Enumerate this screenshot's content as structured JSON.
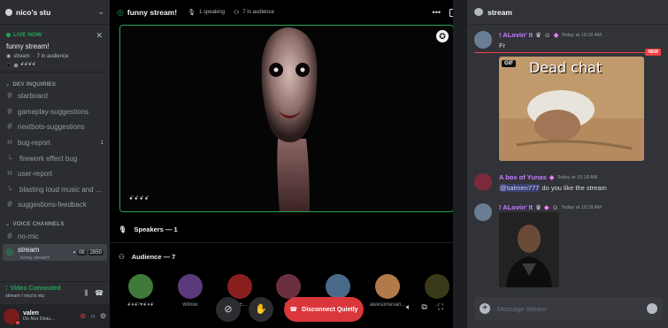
{
  "server": {
    "name": "nico's stu"
  },
  "live": {
    "label": "LIVE NOW",
    "title": "funny stream!",
    "channel": "stream",
    "audience": "7 in audience",
    "audience_tag": "ꗃꗃꗃꗃ"
  },
  "sidebar": {
    "category_text": "DEV INQUIRIES",
    "channels": [
      {
        "label": "starboard",
        "type": "text"
      },
      {
        "label": "gameplay-suggestions",
        "type": "text"
      },
      {
        "label": "nextbots-suggestions",
        "type": "text"
      },
      {
        "label": "bug-report",
        "type": "forum",
        "badge": "1"
      },
      {
        "label": "firework effect bug",
        "type": "thread"
      },
      {
        "label": "user-report",
        "type": "forum"
      },
      {
        "label": "blasting loud music and ...",
        "type": "thread"
      },
      {
        "label": "suggestions-feedback",
        "type": "text"
      }
    ],
    "category_voice": "VOICE CHANNELS",
    "voice_channels": [
      {
        "label": "no-mic"
      },
      {
        "label": "stream",
        "sub": "funny stream!",
        "count_a": "08",
        "count_b": "2850"
      }
    ]
  },
  "voice_status": {
    "label": "Video Connected",
    "sub": "stream / nico's stu"
  },
  "user": {
    "name": "valen",
    "status": "Do Not Distu..."
  },
  "stream": {
    "title": "funny stream!",
    "speaking": "1 speaking",
    "audience": "7 in audience",
    "video_tag": "ꗃꗃꗃꗃ",
    "speakers_label": "Speakers — 1",
    "audience_label": "Audience — 7",
    "members": [
      {
        "name": "ꗃ♦ꗃ/♥ꗃ♦ꗃ",
        "color": "#3f7a3a"
      },
      {
        "name": "Willow",
        "color": "#5a3a7a"
      },
      {
        "name": "KDE...",
        "color": "#8a1f1f"
      },
      {
        "name": "box",
        "color": "#6a3040"
      },
      {
        "name": "...",
        "color": "#4a6a8a"
      },
      {
        "name": "awesomesari...",
        "color": "#b07a4a"
      },
      {
        "name": "...",
        "color": "#3a3a1a"
      }
    ],
    "disconnect_label": "Disconnect Quietly"
  },
  "chat": {
    "channel": "stream",
    "new_tag": "NEW",
    "messages": [
      {
        "author": "! ALovin' It",
        "time": "Today at 10:16 AM",
        "text": "Fr"
      },
      {
        "author": "A box of Yunas",
        "time": "Today at 10:18 AM",
        "mention": "@salmen777",
        "text": " do you like the stream"
      },
      {
        "author": "! ALovin' It",
        "time": "Today at 10:18 AM",
        "text": ""
      }
    ],
    "gif": {
      "tag": "GIF",
      "caption": "Dead chat"
    },
    "input_placeholder": "Message stream"
  },
  "colors": {
    "live_green": "#23a55a",
    "danger": "#da373c",
    "author_purple": "#c77dff"
  }
}
